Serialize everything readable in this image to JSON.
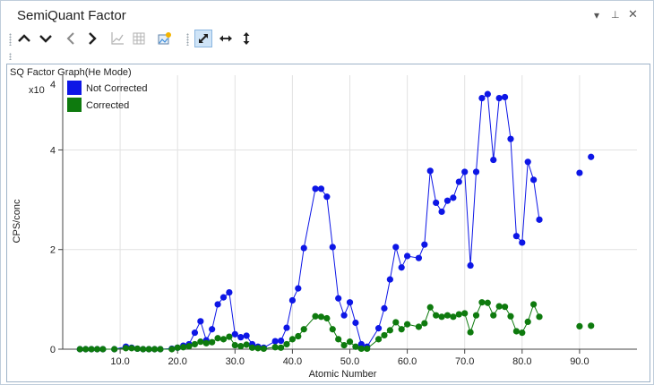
{
  "window": {
    "title": "SemiQuant Factor",
    "controls": {
      "dropdown": "▾",
      "pin": "⊥",
      "close": "✕"
    }
  },
  "toolbar": {
    "buttons": [
      {
        "name": "zoom-in-icon"
      },
      {
        "name": "zoom-out-icon"
      },
      {
        "name": "previous-icon"
      },
      {
        "name": "next-icon"
      },
      {
        "name": "chart-icon"
      },
      {
        "name": "table-icon"
      },
      {
        "name": "export-image-icon"
      },
      {
        "name": "autoscale-icon",
        "active": true
      },
      {
        "name": "autoscale-x-icon"
      },
      {
        "name": "autoscale-y-icon"
      }
    ]
  },
  "chart_data": {
    "type": "scatter",
    "title": "SQ Factor Graph(He Mode)",
    "xlabel": "Atomic Number",
    "ylabel": "CPS/conc",
    "y_multiplier_label": "x10",
    "y_multiplier_exp": "4",
    "xlim": [
      0,
      100
    ],
    "ylim": [
      0,
      5.5
    ],
    "x_ticks": [
      10,
      20,
      30,
      40,
      50,
      60,
      70,
      80,
      90
    ],
    "x_tick_labels": [
      "10.0",
      "20.0",
      "30.0",
      "40.0",
      "50.0",
      "60.0",
      "70.0",
      "80.0",
      "90.0"
    ],
    "y_ticks": [
      0,
      2,
      4
    ],
    "y_tick_labels": [
      "0",
      "2",
      "4"
    ],
    "grid": true,
    "legend_position": "top-left",
    "series": [
      {
        "name": "Not Corrected",
        "color": "#0d16e6",
        "points": [
          [
            3,
            0
          ],
          [
            4,
            0
          ],
          [
            5,
            0
          ],
          [
            6,
            0
          ],
          [
            7,
            0
          ],
          [
            9,
            0
          ],
          [
            11,
            0.05
          ],
          [
            12,
            0.03
          ],
          [
            13,
            0.01
          ],
          [
            14,
            0
          ],
          [
            15,
            0
          ],
          [
            16,
            0
          ],
          [
            17,
            0
          ],
          [
            19,
            0.01
          ],
          [
            20,
            0.03
          ],
          [
            21,
            0.07
          ],
          [
            22,
            0.1
          ],
          [
            23,
            0.33
          ],
          [
            24,
            0.56
          ],
          [
            25,
            0.18
          ],
          [
            26,
            0.4
          ],
          [
            27,
            0.9
          ],
          [
            28,
            1.04
          ],
          [
            29,
            1.14
          ],
          [
            30,
            0.3
          ],
          [
            31,
            0.24
          ],
          [
            32,
            0.27
          ],
          [
            33,
            0.1
          ],
          [
            34,
            0.05
          ],
          [
            35,
            0.03
          ],
          [
            37,
            0.16
          ],
          [
            38,
            0.17
          ],
          [
            39,
            0.43
          ],
          [
            40,
            0.98
          ],
          [
            41,
            1.22
          ],
          [
            42,
            2.03
          ],
          [
            44,
            3.22
          ],
          [
            45,
            3.22
          ],
          [
            46,
            3.06
          ],
          [
            47,
            2.05
          ],
          [
            48,
            1.02
          ],
          [
            49,
            0.68
          ],
          [
            50,
            0.94
          ],
          [
            51,
            0.53
          ],
          [
            52,
            0.1
          ],
          [
            53,
            0.05
          ],
          [
            55,
            0.42
          ],
          [
            56,
            0.82
          ],
          [
            57,
            1.4
          ],
          [
            58,
            2.05
          ],
          [
            59,
            1.64
          ],
          [
            60,
            1.87
          ],
          [
            62,
            1.83
          ],
          [
            63,
            2.1
          ],
          [
            64,
            3.58
          ],
          [
            65,
            2.94
          ],
          [
            66,
            2.76
          ],
          [
            67,
            2.98
          ],
          [
            68,
            3.04
          ],
          [
            69,
            3.36
          ],
          [
            70,
            3.56
          ],
          [
            71,
            1.68
          ],
          [
            72,
            3.56
          ],
          [
            73,
            5.04
          ],
          [
            74,
            5.12
          ],
          [
            75,
            3.8
          ],
          [
            76,
            5.04
          ],
          [
            77,
            5.06
          ],
          [
            78,
            4.22
          ],
          [
            79,
            2.27
          ],
          [
            80,
            2.14
          ],
          [
            81,
            3.76
          ],
          [
            82,
            3.4
          ],
          [
            83,
            2.6
          ],
          [
            90,
            3.54
          ],
          [
            92,
            3.86
          ]
        ],
        "connected_ranges": [
          [
            3,
            83
          ]
        ]
      },
      {
        "name": "Corrected",
        "color": "#0e7a0e",
        "points": [
          [
            3,
            0
          ],
          [
            4,
            0
          ],
          [
            5,
            0
          ],
          [
            6,
            0
          ],
          [
            7,
            0
          ],
          [
            9,
            0
          ],
          [
            11,
            0.02
          ],
          [
            12,
            0.02
          ],
          [
            13,
            0.01
          ],
          [
            14,
            0
          ],
          [
            15,
            0
          ],
          [
            16,
            0
          ],
          [
            17,
            0
          ],
          [
            19,
            0
          ],
          [
            20,
            0.03
          ],
          [
            21,
            0.04
          ],
          [
            22,
            0.06
          ],
          [
            23,
            0.1
          ],
          [
            24,
            0.15
          ],
          [
            25,
            0.12
          ],
          [
            26,
            0.14
          ],
          [
            27,
            0.22
          ],
          [
            28,
            0.2
          ],
          [
            29,
            0.25
          ],
          [
            30,
            0.08
          ],
          [
            31,
            0.06
          ],
          [
            32,
            0.09
          ],
          [
            33,
            0.03
          ],
          [
            34,
            0.02
          ],
          [
            35,
            0.01
          ],
          [
            37,
            0.04
          ],
          [
            38,
            0.03
          ],
          [
            39,
            0.1
          ],
          [
            40,
            0.2
          ],
          [
            41,
            0.26
          ],
          [
            42,
            0.4
          ],
          [
            44,
            0.66
          ],
          [
            45,
            0.65
          ],
          [
            46,
            0.62
          ],
          [
            47,
            0.4
          ],
          [
            48,
            0.2
          ],
          [
            49,
            0.08
          ],
          [
            50,
            0.15
          ],
          [
            51,
            0.05
          ],
          [
            52,
            0.01
          ],
          [
            53,
            0.01
          ],
          [
            55,
            0.2
          ],
          [
            56,
            0.28
          ],
          [
            57,
            0.38
          ],
          [
            58,
            0.54
          ],
          [
            59,
            0.4
          ],
          [
            60,
            0.5
          ],
          [
            62,
            0.45
          ],
          [
            63,
            0.52
          ],
          [
            64,
            0.84
          ],
          [
            65,
            0.68
          ],
          [
            66,
            0.65
          ],
          [
            67,
            0.68
          ],
          [
            68,
            0.65
          ],
          [
            69,
            0.7
          ],
          [
            70,
            0.72
          ],
          [
            71,
            0.34
          ],
          [
            72,
            0.68
          ],
          [
            73,
            0.94
          ],
          [
            74,
            0.93
          ],
          [
            75,
            0.68
          ],
          [
            76,
            0.86
          ],
          [
            77,
            0.85
          ],
          [
            78,
            0.66
          ],
          [
            79,
            0.36
          ],
          [
            80,
            0.33
          ],
          [
            81,
            0.55
          ],
          [
            82,
            0.9
          ],
          [
            83,
            0.65
          ],
          [
            90,
            0.46
          ],
          [
            92,
            0.47
          ]
        ],
        "connected_ranges": [
          [
            3,
            83
          ]
        ]
      }
    ]
  }
}
